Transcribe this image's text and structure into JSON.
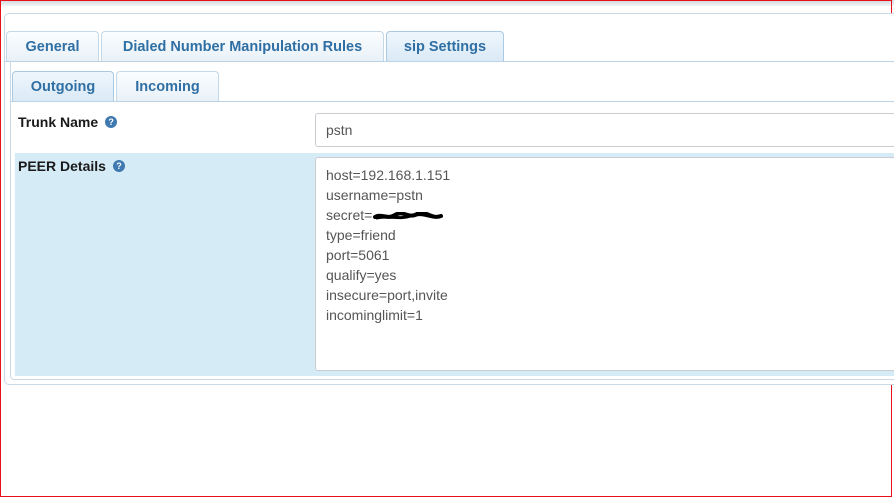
{
  "tabs": {
    "main": [
      {
        "label": "General",
        "active": false
      },
      {
        "label": "Dialed Number Manipulation Rules",
        "active": false
      },
      {
        "label": "sip Settings",
        "active": true
      }
    ],
    "sub": [
      {
        "label": "Outgoing",
        "active": true
      },
      {
        "label": "Incoming",
        "active": false
      }
    ]
  },
  "fields": {
    "trunk_name": {
      "label": "Trunk Name",
      "value": "pstn"
    },
    "peer_details": {
      "label": "PEER Details",
      "lines": [
        "host=192.168.1.151",
        "username=pstn",
        "secret=",
        "type=friend",
        "port=5061",
        "qualify=yes",
        "insecure=port,invite",
        "incominglimit=1"
      ]
    }
  },
  "icons": {
    "help": "question-circle-icon"
  },
  "colors": {
    "tab_text": "#2f6fa3",
    "peer_row_bg": "#d5ebf6",
    "frame_border": "#e8101a"
  }
}
